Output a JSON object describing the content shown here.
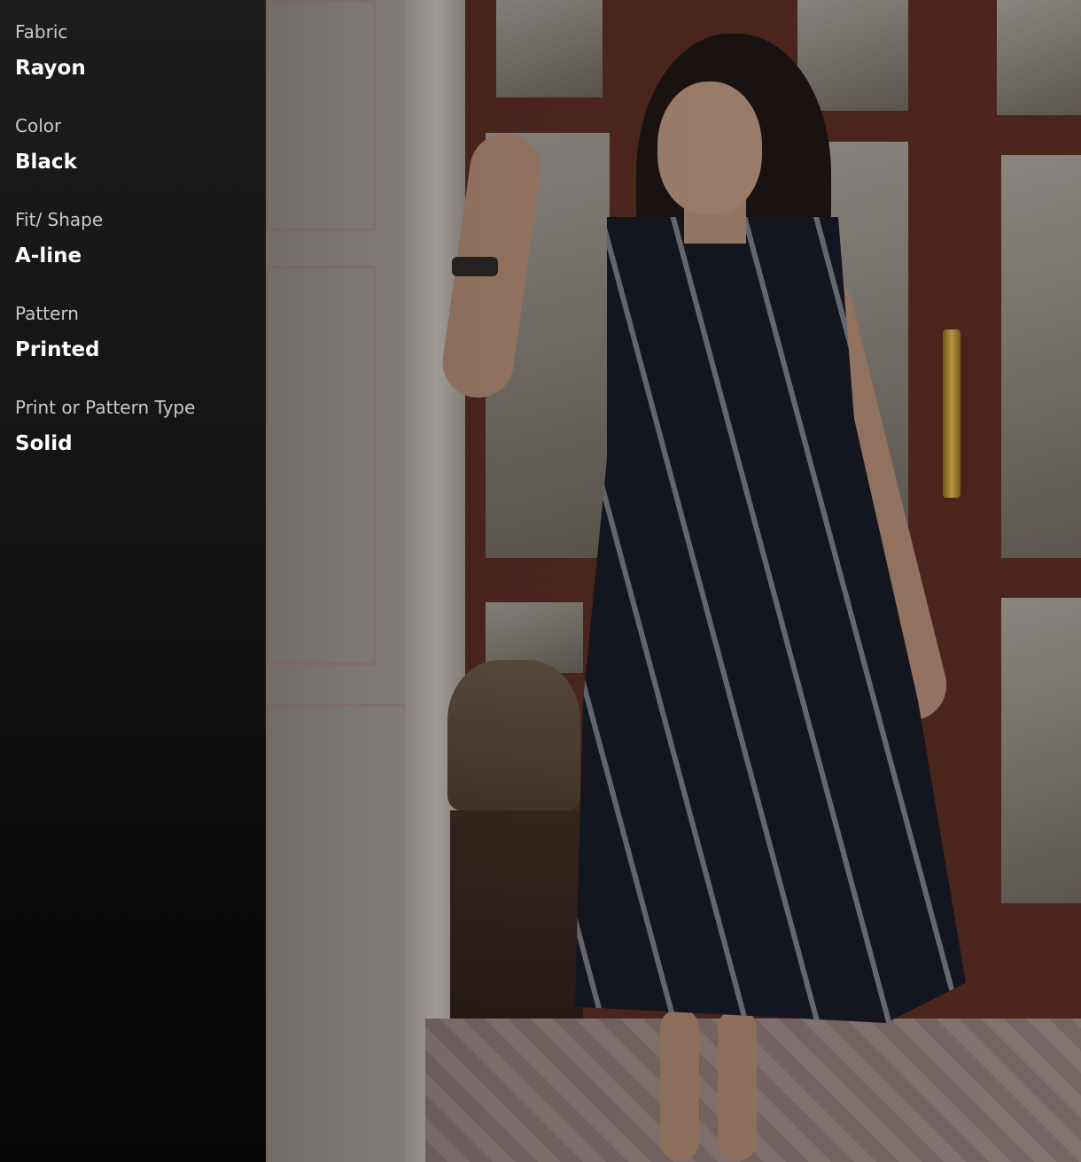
{
  "product_attributes": [
    {
      "label": "Fabric",
      "value": "Rayon"
    },
    {
      "label": "Color",
      "value": "Black"
    },
    {
      "label": "Fit/ Shape",
      "value": "A-line"
    },
    {
      "label": "Pattern",
      "value": "Printed"
    },
    {
      "label": "Print or Pattern Type",
      "value": "Solid"
    }
  ],
  "colors": {
    "overlay_top": "#1c1c1c",
    "overlay_bottom": "#050505",
    "label_text": "#c9c9c9",
    "value_text": "#ffffff",
    "dress": "#141722",
    "door_wood": "#5a2a1e",
    "handle_brass": "#e0b64a"
  }
}
